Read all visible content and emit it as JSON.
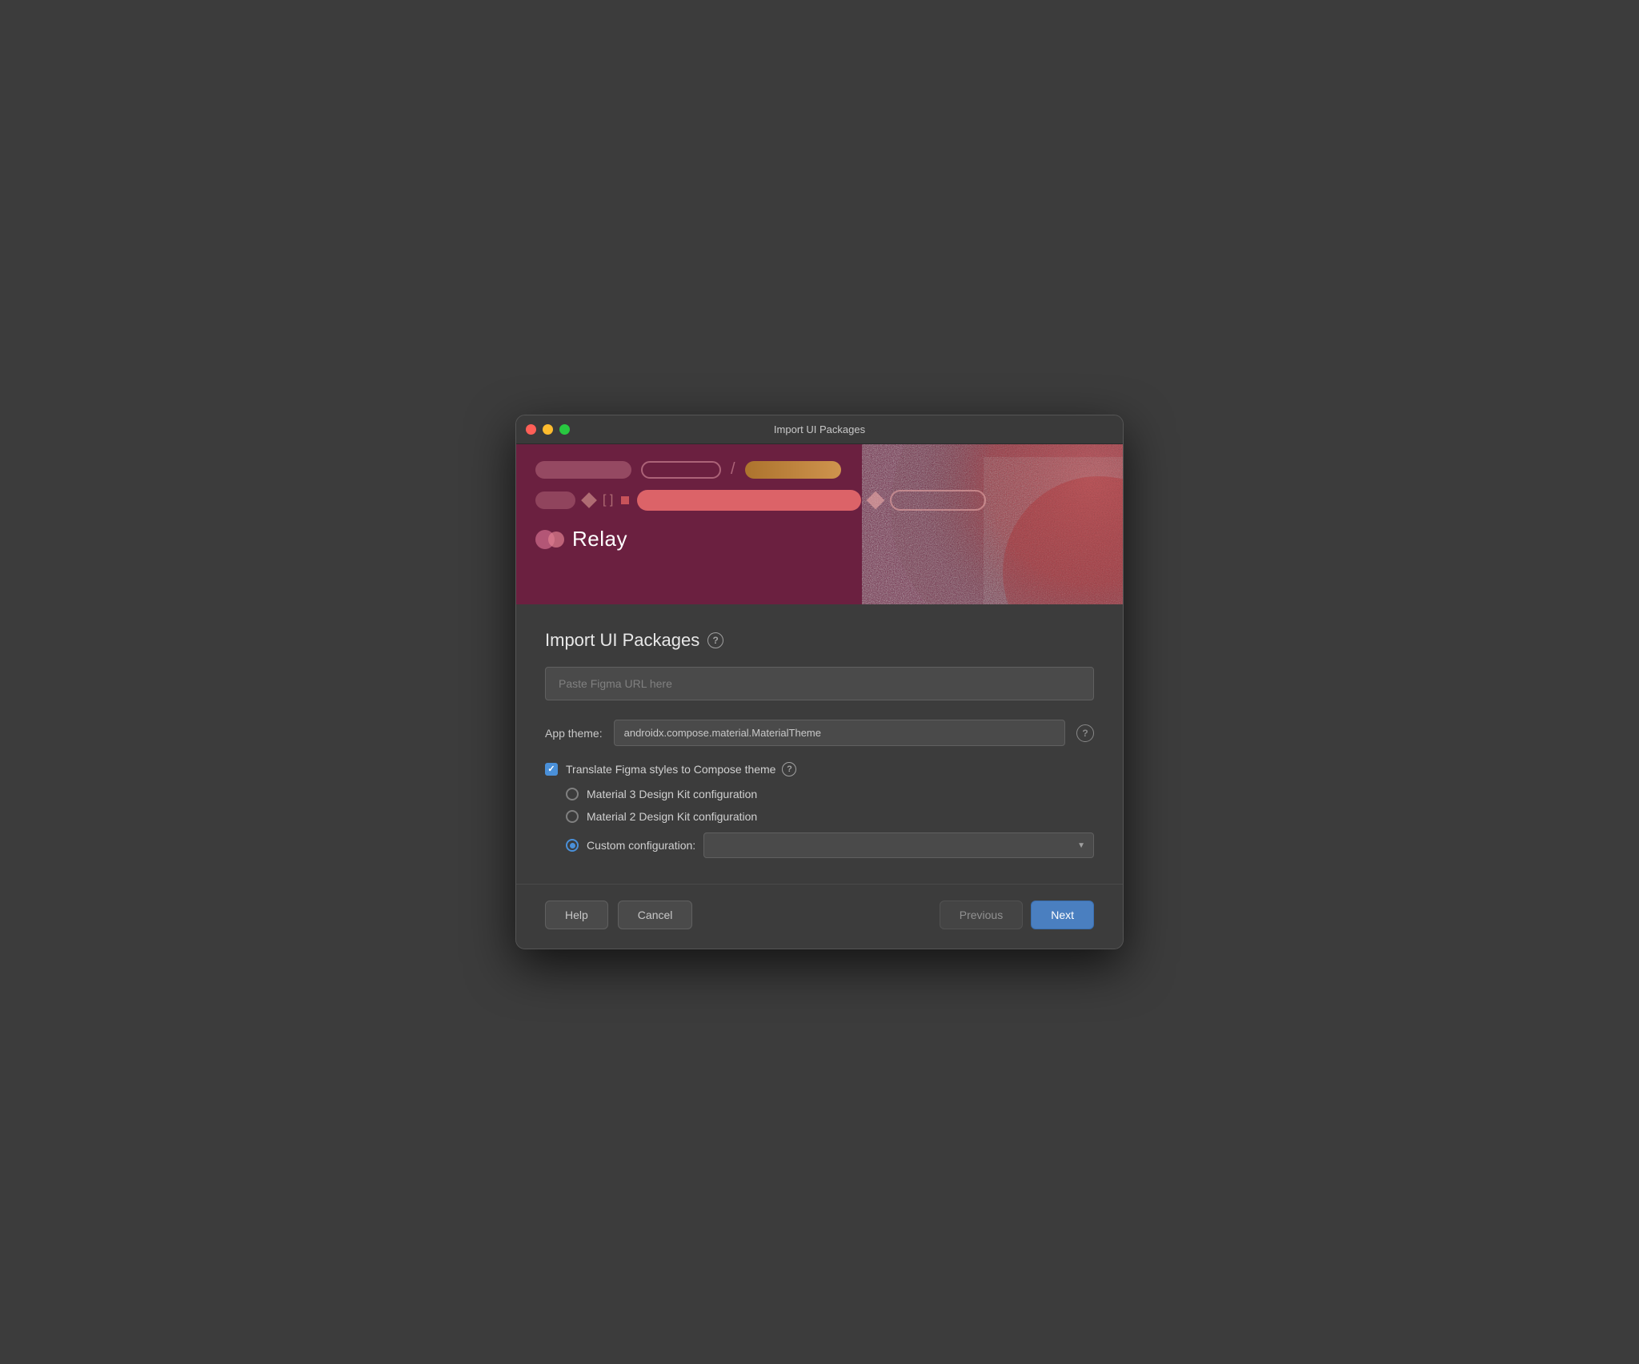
{
  "window": {
    "title": "Import UI Packages"
  },
  "header": {
    "logo_text": "Relay"
  },
  "page": {
    "title": "Import UI Packages",
    "help_icon_label": "?",
    "url_input_placeholder": "Paste Figma URL here",
    "url_input_value": "",
    "app_theme_label": "App theme:",
    "app_theme_value": "androidx.compose.material.MaterialTheme",
    "app_theme_help": "?",
    "translate_checkbox_label": "Translate Figma styles to Compose theme",
    "translate_checkbox_help": "?",
    "translate_checked": true,
    "radio_options": [
      {
        "id": "material3",
        "label": "Material 3 Design Kit configuration",
        "selected": false
      },
      {
        "id": "material2",
        "label": "Material 2 Design Kit configuration",
        "selected": false
      },
      {
        "id": "custom",
        "label": "Custom configuration:",
        "selected": true
      }
    ],
    "custom_config_value": ""
  },
  "footer": {
    "help_label": "Help",
    "cancel_label": "Cancel",
    "previous_label": "Previous",
    "next_label": "Next"
  }
}
